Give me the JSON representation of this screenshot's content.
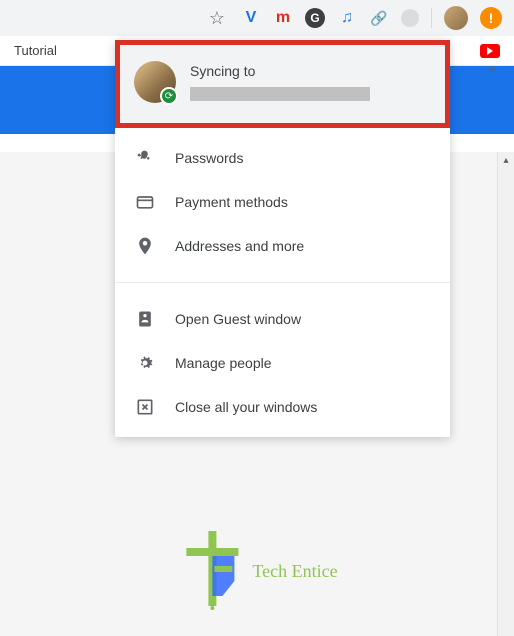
{
  "toolbar": {
    "extensions": {
      "y": "V",
      "m": "m",
      "g": "G"
    }
  },
  "bookmarksBar": {
    "tutorial": "Tutorial",
    "overflow": "»"
  },
  "profileMenu": {
    "syncHeader": {
      "title": "Syncing to"
    },
    "section1": [
      {
        "icon": "key",
        "label": "Passwords"
      },
      {
        "icon": "card",
        "label": "Payment methods"
      },
      {
        "icon": "pin",
        "label": "Addresses and more"
      }
    ],
    "section2": [
      {
        "icon": "guest",
        "label": "Open Guest window"
      },
      {
        "icon": "gear",
        "label": "Manage people"
      },
      {
        "icon": "close",
        "label": "Close all your windows"
      }
    ]
  },
  "watermark": {
    "text": "Tech Entice"
  }
}
